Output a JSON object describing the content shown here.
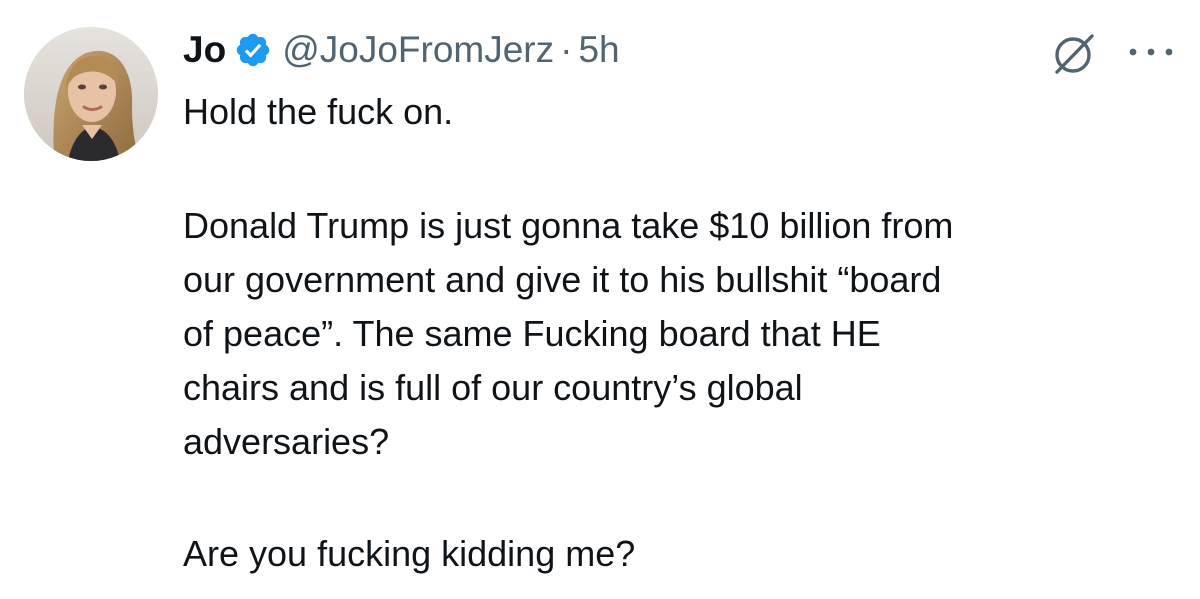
{
  "author": {
    "display_name": "Jo",
    "handle": "@JoJoFromJerz",
    "separator": "·",
    "time": "5h",
    "verified": true
  },
  "icons": {
    "avatar": "profile-photo",
    "verified": "verified-badge-icon",
    "grok": "grok-icon",
    "more": "more-options-icon"
  },
  "colors": {
    "verified_blue": "#1d9bf0",
    "secondary_text": "#536471",
    "primary_text": "#0f1419"
  },
  "tweet": {
    "paragraph_1": "Hold the fuck on.",
    "paragraph_2_lines": [
      "Donald Trump is just gonna take $10 billion from",
      "our government and give it to his bullshit “board",
      "of peace”. The same Fucking board that HE",
      "chairs and is full of our country’s global",
      "adversaries?"
    ],
    "paragraph_3": "Are you fucking kidding me?"
  }
}
